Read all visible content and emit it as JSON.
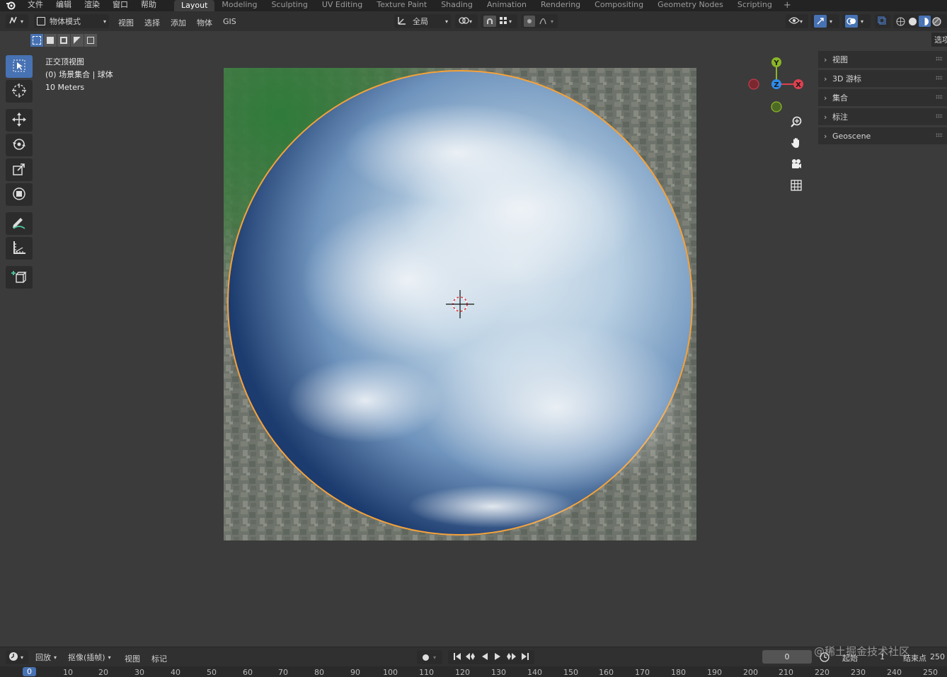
{
  "topbar": {
    "menus": [
      "文件",
      "编辑",
      "渲染",
      "窗口",
      "帮助"
    ],
    "workspaces": [
      "Layout",
      "Modeling",
      "Sculpting",
      "UV Editing",
      "Texture Paint",
      "Shading",
      "Animation",
      "Rendering",
      "Compositing",
      "Geometry Nodes",
      "Scripting"
    ],
    "active_workspace": "Layout",
    "add_tab": "+"
  },
  "header": {
    "mode": "物体模式",
    "menus": [
      "视图",
      "选择",
      "添加",
      "物体",
      "GIS"
    ],
    "orientation": "全局"
  },
  "viewport": {
    "view_name": "正交顶视图",
    "collection": "(0) 场景集合 | 球体",
    "scale": "10 Meters",
    "colors": {
      "selection_outline": "#f5a23a",
      "active_tool": "#4772b3"
    }
  },
  "gizmo": {
    "x": "X",
    "y": "Y",
    "z": "Z"
  },
  "npanel": {
    "tab_label": "选项",
    "sections": [
      "视图",
      "3D 游标",
      "集合",
      "标注",
      "Geoscene"
    ]
  },
  "timeline": {
    "menus": [
      "回放",
      "抠像(插帧)",
      "视图",
      "标记"
    ],
    "current_frame": "0",
    "start_label": "起始",
    "start_value": "1",
    "end_label": "结束点",
    "end_value": "250",
    "ruler": [
      "0",
      "10",
      "20",
      "30",
      "40",
      "50",
      "60",
      "70",
      "80",
      "90",
      "100",
      "110",
      "120",
      "130",
      "140",
      "150",
      "160",
      "170",
      "180",
      "190",
      "200",
      "210",
      "220",
      "230",
      "240",
      "250"
    ]
  },
  "watermark": "@稀土掘金技术社区"
}
